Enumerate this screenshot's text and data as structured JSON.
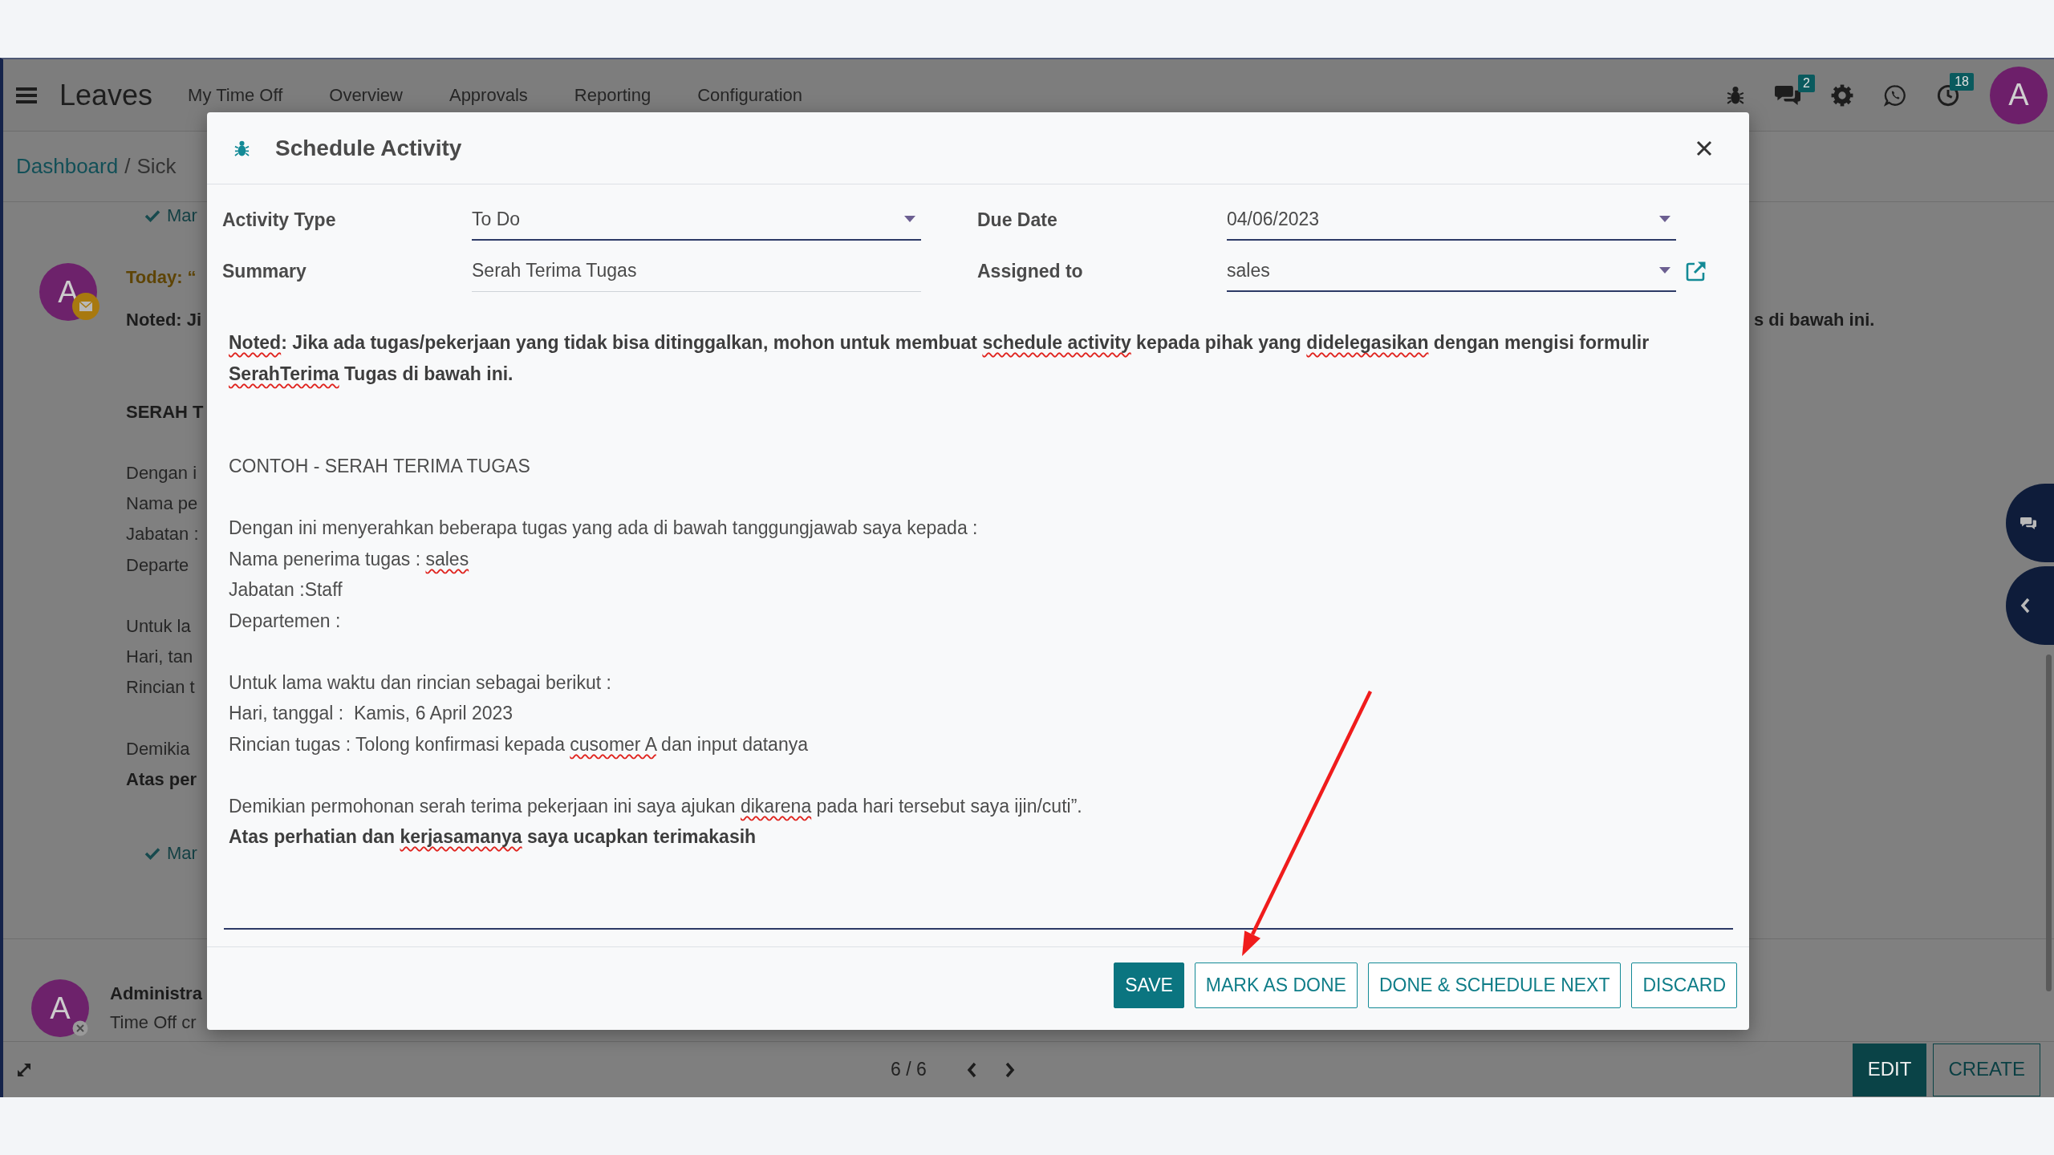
{
  "navbar": {
    "app_name": "Leaves",
    "menu": [
      "My Time Off",
      "Overview",
      "Approvals",
      "Reporting",
      "Configuration"
    ],
    "systray": [
      {
        "kind": "bug"
      },
      {
        "kind": "chat",
        "badge": "2"
      },
      {
        "kind": "settings"
      },
      {
        "kind": "phone"
      },
      {
        "kind": "clock",
        "badge": "18"
      }
    ],
    "avatar": "A"
  },
  "breadcrumb": {
    "items": [
      "Dashboard",
      "Sick"
    ],
    "separator": "/"
  },
  "chatter": {
    "top_link": "Mar",
    "activity": {
      "avatar": "A",
      "due": "Today: “",
      "note": [
        {
          "kind": "intro",
          "lines": [
            {
              "text": "Noted: Ji",
              "bold": true
            }
          ]
        },
        {
          "kind": "heading",
          "lines": [
            {
              "text": "SERAH T",
              "bold": true
            }
          ]
        },
        {
          "kind": "section",
          "lines": [
            {
              "text": "Dengan i",
              "bold": false
            },
            {
              "text": "Nama pe",
              "bold": false
            },
            {
              "text": "Jabatan :",
              "bold": false
            },
            {
              "text": "Departe",
              "bold": false
            }
          ]
        },
        {
          "kind": "section",
          "lines": [
            {
              "text": "Untuk la",
              "bold": false
            },
            {
              "text": "Hari, tan",
              "bold": false
            },
            {
              "text": "Rincian t",
              "bold": false
            }
          ]
        },
        {
          "kind": "section",
          "lines": [
            {
              "text": "Demikia",
              "bold": false
            },
            {
              "text": "Atas per",
              "bold": true
            }
          ]
        }
      ],
      "note_tail": {
        "text": "s di bawah ini.",
        "bold": true
      },
      "link": "Mar"
    },
    "message": {
      "avatar": "A",
      "author": "Administra",
      "body": "Time Off cr"
    }
  },
  "dialog": {
    "title": "Schedule Activity",
    "fields": [
      {
        "label": "Activity Type",
        "value": "To Do",
        "kind": "select"
      },
      {
        "label": "Due Date",
        "value": "04/06/2023",
        "kind": "select"
      },
      {
        "label": "Summary",
        "value": "Serah Terima Tugas",
        "kind": "text"
      },
      {
        "label": "Assigned to",
        "value": "sales",
        "kind": "select_link"
      }
    ],
    "note": [
      {
        "kind": "intro",
        "lines": [
          {
            "bold": true,
            "segments": [
              {
                "text": "Noted",
                "misspelled": true
              },
              {
                "text": ": Jika ada tugas/pekerjaan yang tidak bisa ditinggalkan, mohon untuk membuat ",
                "misspelled": false
              },
              {
                "text": "schedule activity",
                "misspelled": true
              },
              {
                "text": " kepada pihak yang ",
                "misspelled": false
              },
              {
                "text": "didelegasikan",
                "misspelled": true
              },
              {
                "text": " dengan mengisi formulir ",
                "misspelled": false
              },
              {
                "text": "SerahTerima",
                "misspelled": true
              },
              {
                "text": " Tugas di bawah ini.",
                "misspelled": false
              }
            ]
          }
        ]
      },
      {
        "kind": "heading",
        "lines": [
          {
            "bold": false,
            "segments": [
              {
                "text": "CONTOH - SERAH TERIMA TUGAS",
                "misspelled": false
              }
            ]
          }
        ]
      },
      {
        "kind": "section",
        "lines": [
          {
            "bold": false,
            "segments": [
              {
                "text": "Dengan ini menyerahkan beberapa tugas yang ada di bawah tanggungjawab saya kepada :",
                "misspelled": false
              }
            ]
          },
          {
            "bold": false,
            "segments": [
              {
                "text": "Nama penerima tugas : ",
                "misspelled": false
              },
              {
                "text": "sales",
                "misspelled": true
              }
            ]
          },
          {
            "bold": false,
            "segments": [
              {
                "text": "Jabatan :Staff",
                "misspelled": false
              }
            ]
          },
          {
            "bold": false,
            "segments": [
              {
                "text": "Departemen :",
                "misspelled": false
              }
            ]
          }
        ]
      },
      {
        "kind": "section",
        "lines": [
          {
            "bold": false,
            "segments": [
              {
                "text": "Untuk lama waktu dan rincian sebagai berikut :",
                "misspelled": false
              }
            ]
          },
          {
            "bold": false,
            "segments": [
              {
                "text": "Hari, tanggal :  Kamis, 6 April 2023",
                "misspelled": false
              }
            ]
          },
          {
            "bold": false,
            "segments": [
              {
                "text": "Rincian tugas : Tolong konfirmasi kepada ",
                "misspelled": false
              },
              {
                "text": "cusomer A",
                "misspelled": true
              },
              {
                "text": " dan input datanya",
                "misspelled": false
              }
            ]
          }
        ]
      },
      {
        "kind": "section",
        "lines": [
          {
            "bold": false,
            "segments": [
              {
                "text": "Demikian permohonan serah terima pekerjaan ini saya ajukan ",
                "misspelled": false
              },
              {
                "text": "dikarena",
                "misspelled": true
              },
              {
                "text": " pada hari tersebut saya ijin/cuti”.",
                "misspelled": false
              }
            ]
          },
          {
            "bold": true,
            "segments": [
              {
                "text": "Atas perhatian dan ",
                "misspelled": false
              },
              {
                "text": "kerjasamanya",
                "misspelled": true
              },
              {
                "text": " saya ucapkan terimakasih",
                "misspelled": false
              }
            ]
          }
        ]
      }
    ],
    "buttons": [
      {
        "label": "SAVE",
        "kind": "primary"
      },
      {
        "label": "MARK AS DONE",
        "kind": "secondary"
      },
      {
        "label": "DONE & SCHEDULE NEXT",
        "kind": "secondary"
      },
      {
        "label": "DISCARD",
        "kind": "secondary"
      }
    ]
  },
  "pager": {
    "value": "6 / 6"
  },
  "actions": [
    {
      "label": "EDIT",
      "kind": "primary"
    },
    {
      "label": "CREATE",
      "kind": "secondary"
    }
  ]
}
